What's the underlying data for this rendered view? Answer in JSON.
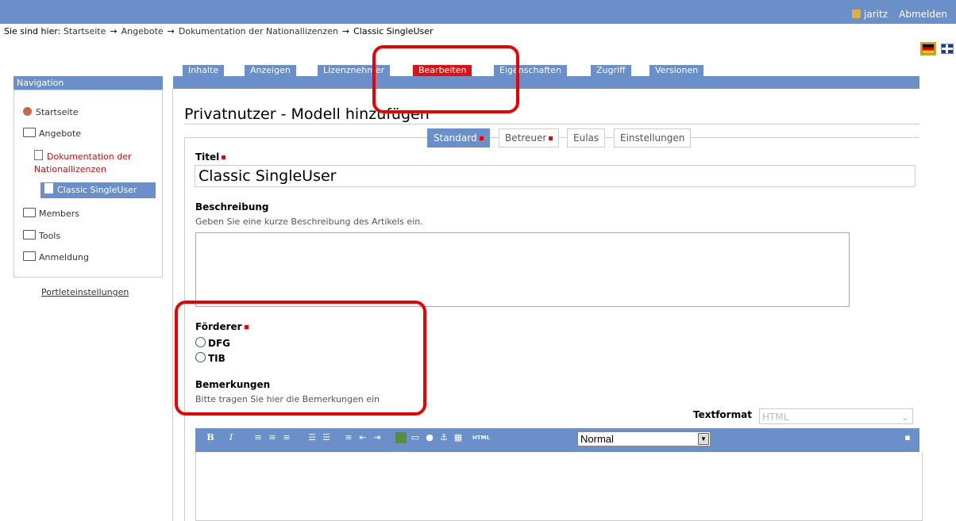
{
  "topbar": {
    "user": "jaritz",
    "logout": "Abmelden"
  },
  "breadcrumb": {
    "prefix": "Sie sind hier:",
    "items": [
      "Startseite",
      "Angebote",
      "Dokumentation der Nationallizenzen",
      "Classic SingleUser"
    ],
    "arrow": "→"
  },
  "tabs": [
    "Inhalte",
    "Anzeigen",
    "Lizenznehmer",
    "Bearbeiten",
    "Eigenschaften",
    "Zugriff",
    "Versionen"
  ],
  "nav": {
    "header": "Navigation",
    "items": [
      "Startseite",
      "Angebote",
      "Dokumentation der",
      "Nationallizenzen",
      "Classic SingleUser",
      "Members",
      "Tools",
      "Anmeldung"
    ],
    "settings": "Portleteinstellungen"
  },
  "page": {
    "title": "Privatnutzer - Modell hinzufügen",
    "subtabs": [
      "Standard",
      "Betreuer",
      "Eulas",
      "Einstellungen"
    ]
  },
  "form": {
    "titel_label": "Titel",
    "titel_value": "Classic SingleUser",
    "beschreibung_label": "Beschreibung",
    "beschreibung_help": "Geben Sie eine kurze Beschreibung des Artikels ein.",
    "foerderer_label": "Förderer",
    "foerderer_options": [
      "DFG",
      "TIB"
    ],
    "bemerkungen_label": "Bemerkungen",
    "bemerkungen_help": "Bitte tragen Sie hier die Bemerkungen ein",
    "textformat_label": "Textformat",
    "textformat_value": "HTML",
    "style_value": "Normal"
  },
  "editor_buttons": [
    "bold-icon",
    "italic-icon",
    "align-left-icon",
    "align-center-icon",
    "align-right-icon",
    "ordered-list-icon",
    "unordered-list-icon",
    "definition-list-icon",
    "outdent-icon",
    "indent-icon",
    "image-icon",
    "link-icon",
    "globe-icon",
    "anchor-icon",
    "table-icon",
    "html-icon"
  ],
  "colors": {
    "accent": "#6b8fc9",
    "active_tab": "#e01010",
    "annotation": "#e00000"
  }
}
